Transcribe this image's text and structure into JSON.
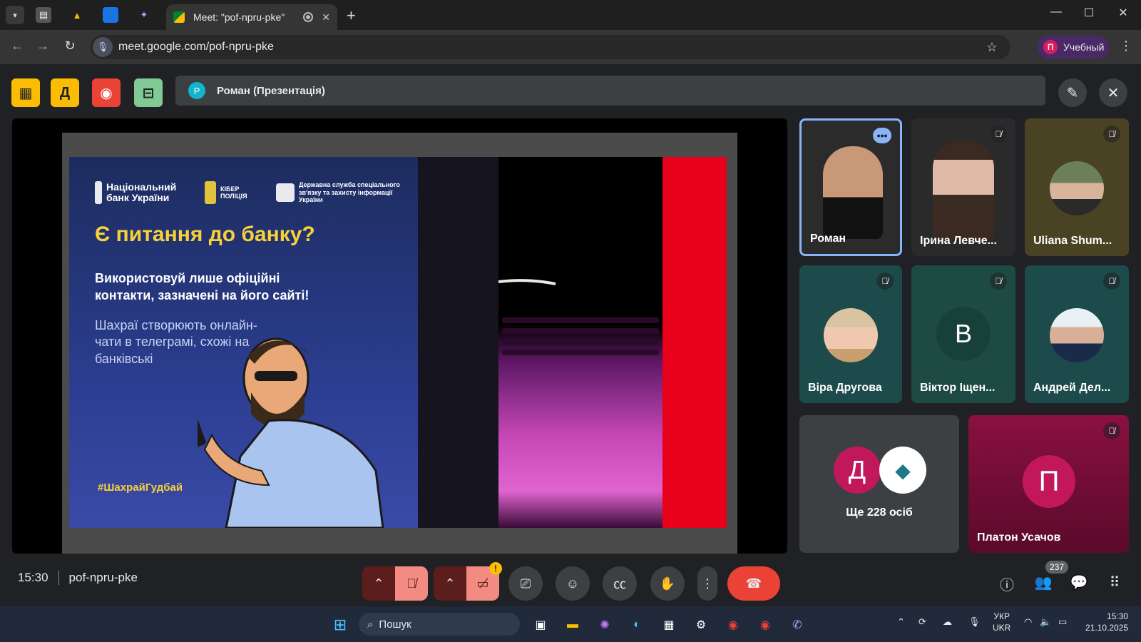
{
  "browser": {
    "active_tab_title": "Meet: \"pof-npru-pke\"",
    "url": "meet.google.com/pof-npru-pke",
    "profile_initial": "П",
    "profile_name": "Учебный"
  },
  "meet": {
    "presenter_initial": "Р",
    "presenter_label": "Роман (Презентація)",
    "meeting_code": "pof-npru-pke",
    "time": "15:30",
    "participants_count": "237"
  },
  "slide": {
    "logo1": "Національний банк України",
    "logo2": "КІБЕР ПОЛІЦІЯ",
    "logo3": "Державна служба спеціального зв'язку та захисту інформації України",
    "heading": "Є питання до банку?",
    "subheading": "Використовуй лише офіційні контакти, зазначені на його сайті!",
    "body": "Шахраї створюють онлайн-чати в телеграмі, схожі на банківські",
    "hashtag": "#ШахрайГудбай"
  },
  "participants": [
    {
      "name": "Роман"
    },
    {
      "name": "Ірина Левче..."
    },
    {
      "name": "Uliana Shum..."
    },
    {
      "name": "Віра Другова"
    },
    {
      "name": "Віктор Іщен...",
      "initial": "В"
    },
    {
      "name": "Андрей Дел..."
    },
    {
      "name": "Платон Усачов",
      "initial": "П"
    }
  ],
  "others": {
    "initial": "Д",
    "label": "Ще 228 осіб"
  },
  "taskbar": {
    "search_placeholder": "Пошук",
    "lang_top": "УКР",
    "lang_bottom": "UKR",
    "clock_time": "15:30",
    "clock_date": "21.10.2025"
  },
  "colors": {
    "accent_blue": "#8ab4f8",
    "end_call": "#ea4335",
    "extension_yellow": "#fbbc04",
    "record_red": "#ea4335",
    "extension_green": "#81c995"
  }
}
